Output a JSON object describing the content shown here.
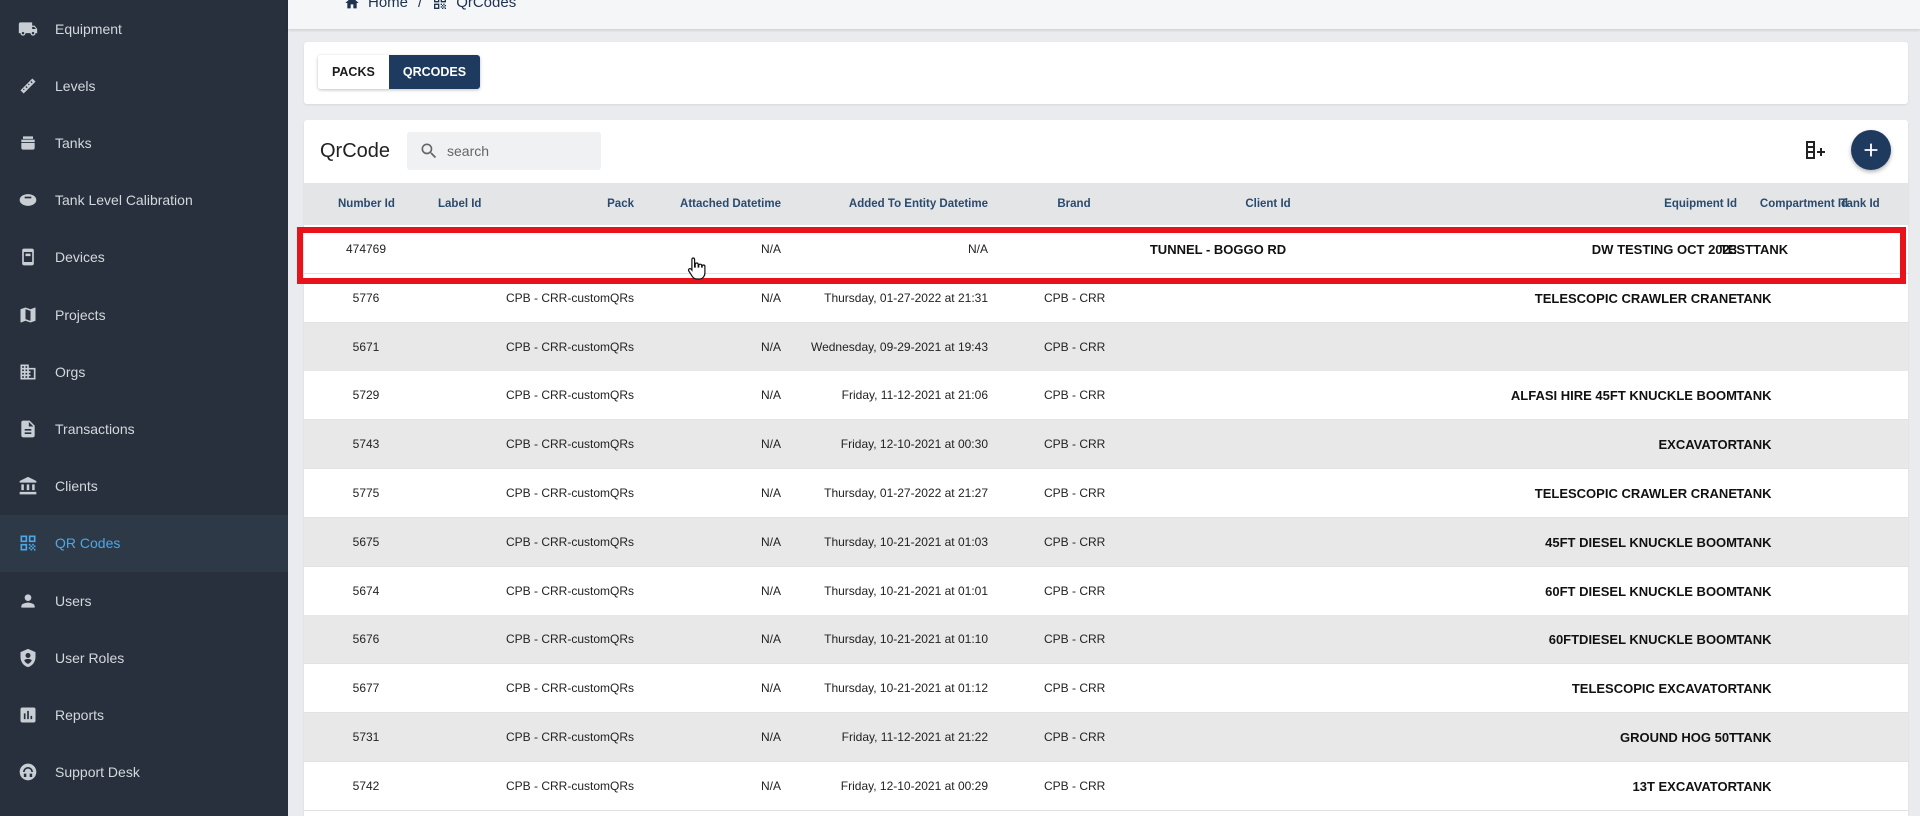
{
  "sidebar": {
    "items": [
      {
        "label": "Equipment",
        "icon": "truck-icon"
      },
      {
        "label": "Levels",
        "icon": "ruler-icon"
      },
      {
        "label": "Tanks",
        "icon": "tank-icon"
      },
      {
        "label": "Tank Level Calibration",
        "icon": "gauge-icon"
      },
      {
        "label": "Devices",
        "icon": "device-icon"
      },
      {
        "label": "Projects",
        "icon": "map-icon"
      },
      {
        "label": "Orgs",
        "icon": "building-icon"
      },
      {
        "label": "Transactions",
        "icon": "document-icon"
      },
      {
        "label": "Clients",
        "icon": "bank-icon"
      },
      {
        "label": "QR Codes",
        "icon": "qr-code-icon",
        "active": true
      },
      {
        "label": "Users",
        "icon": "user-icon"
      },
      {
        "label": "User Roles",
        "icon": "shield-user-icon"
      },
      {
        "label": "Reports",
        "icon": "bar-chart-icon"
      },
      {
        "label": "Support Desk",
        "icon": "support-icon"
      }
    ]
  },
  "breadcrumb": {
    "home": "Home",
    "separator": "/",
    "current": "QrCodes"
  },
  "tabs": [
    {
      "label": "PACKS"
    },
    {
      "label": "QRCODES",
      "active": true
    }
  ],
  "table": {
    "title": "QrCode",
    "search_placeholder": "search",
    "columns": [
      "Number Id",
      "Label Id",
      "Pack",
      "Attached Datetime",
      "Added To Entity Datetime",
      "Brand",
      "Client Id",
      "Equipment Id",
      "Compartment Id",
      "Tank Id"
    ],
    "rows": [
      {
        "number_id": "474769",
        "label_id": "",
        "pack": "",
        "attached": "N/A",
        "added": "N/A",
        "brand": "",
        "client": "TUNNEL - BOGGO RD",
        "equipment": "DW TESTING OCT 2023",
        "compartment": "TESTTANK",
        "tank": ""
      },
      {
        "number_id": "5776",
        "label_id": "",
        "pack": "CPB - CRR-customQRs",
        "attached": "N/A",
        "added": "Thursday, 01-27-2022 at 21:31",
        "brand": "CPB - CRR",
        "client": "",
        "equipment": "TELESCOPIC CRAWLER CRANE",
        "compartment": "TANK",
        "tank": ""
      },
      {
        "number_id": "5671",
        "label_id": "",
        "pack": "CPB - CRR-customQRs",
        "attached": "N/A",
        "added": "Wednesday, 09-29-2021 at 19:43",
        "brand": "CPB - CRR",
        "client": "",
        "equipment": "",
        "compartment": "",
        "tank": ""
      },
      {
        "number_id": "5729",
        "label_id": "",
        "pack": "CPB - CRR-customQRs",
        "attached": "N/A",
        "added": "Friday, 11-12-2021 at 21:06",
        "brand": "CPB - CRR",
        "client": "",
        "equipment": "ALFASI HIRE 45FT KNUCKLE BOOM",
        "compartment": "TANK",
        "tank": ""
      },
      {
        "number_id": "5743",
        "label_id": "",
        "pack": "CPB - CRR-customQRs",
        "attached": "N/A",
        "added": "Friday, 12-10-2021 at 00:30",
        "brand": "CPB - CRR",
        "client": "",
        "equipment": "EXCAVATOR",
        "compartment": "TANK",
        "tank": ""
      },
      {
        "number_id": "5775",
        "label_id": "",
        "pack": "CPB - CRR-customQRs",
        "attached": "N/A",
        "added": "Thursday, 01-27-2022 at 21:27",
        "brand": "CPB - CRR",
        "client": "",
        "equipment": "TELESCOPIC CRAWLER CRANE",
        "compartment": "TANK",
        "tank": ""
      },
      {
        "number_id": "5675",
        "label_id": "",
        "pack": "CPB - CRR-customQRs",
        "attached": "N/A",
        "added": "Thursday, 10-21-2021 at 01:03",
        "brand": "CPB - CRR",
        "client": "",
        "equipment": "45FT DIESEL KNUCKLE BOOM",
        "compartment": "TANK",
        "tank": ""
      },
      {
        "number_id": "5674",
        "label_id": "",
        "pack": "CPB - CRR-customQRs",
        "attached": "N/A",
        "added": "Thursday, 10-21-2021 at 01:01",
        "brand": "CPB - CRR",
        "client": "",
        "equipment": "60FT DIESEL KNUCKLE BOOM",
        "compartment": "TANK",
        "tank": ""
      },
      {
        "number_id": "5676",
        "label_id": "",
        "pack": "CPB - CRR-customQRs",
        "attached": "N/A",
        "added": "Thursday, 10-21-2021 at 01:10",
        "brand": "CPB - CRR",
        "client": "",
        "equipment": "60FTDIESEL KNUCKLE BOOM",
        "compartment": "TANK",
        "tank": ""
      },
      {
        "number_id": "5677",
        "label_id": "",
        "pack": "CPB - CRR-customQRs",
        "attached": "N/A",
        "added": "Thursday, 10-21-2021 at 01:12",
        "brand": "CPB - CRR",
        "client": "",
        "equipment": "TELESCOPIC EXCAVATOR",
        "compartment": "TANK",
        "tank": ""
      },
      {
        "number_id": "5731",
        "label_id": "",
        "pack": "CPB - CRR-customQRs",
        "attached": "N/A",
        "added": "Friday, 11-12-2021 at 21:22",
        "brand": "CPB - CRR",
        "client": "",
        "equipment": "GROUND HOG 50T",
        "compartment": "TANK",
        "tank": ""
      },
      {
        "number_id": "5742",
        "label_id": "",
        "pack": "CPB - CRR-customQRs",
        "attached": "N/A",
        "added": "Friday, 12-10-2021 at 00:29",
        "brand": "CPB - CRR",
        "client": "",
        "equipment": "13T EXCAVATOR",
        "compartment": "TANK",
        "tank": ""
      }
    ]
  },
  "colors": {
    "sidebar_bg": "#27303c",
    "accent": "#1f3a5f",
    "active_link": "#4aa8e8",
    "highlight": "#e8121a"
  }
}
